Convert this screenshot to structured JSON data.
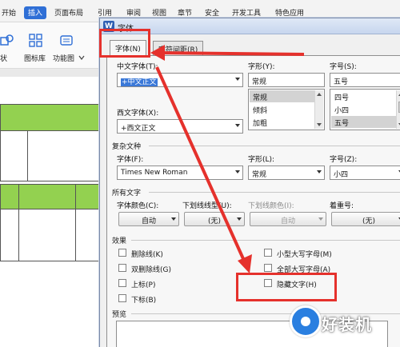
{
  "ribbon": {
    "tabs": [
      "开始",
      "插入",
      "页面布局",
      "引用",
      "审阅",
      "视图",
      "章节",
      "安全",
      "开发工具",
      "特色应用"
    ],
    "active_tab": "插入",
    "buttons": [
      "状",
      "图标库",
      "功能图"
    ]
  },
  "dialog": {
    "title": "字体",
    "tabs": [
      "字体(N)",
      "字符间距(R)"
    ],
    "chinese_font": {
      "label": "中文字体(T):",
      "value": "+中文正文"
    },
    "style": {
      "label": "字形(Y):",
      "value": "常规",
      "options": [
        "常规",
        "倾斜",
        "加粗"
      ],
      "selected": "常规"
    },
    "size": {
      "label": "字号(S):",
      "value": "五号",
      "options": [
        "四号",
        "小四",
        "五号"
      ],
      "selected": "五号"
    },
    "western_font": {
      "label": "西文字体(X):",
      "value": "+西文正文"
    },
    "complex": {
      "section": "复杂文种",
      "font_label": "字体(F):",
      "font_value": "Times New Roman",
      "style_label": "字形(L):",
      "style_value": "常规",
      "size_label": "字号(Z):",
      "size_value": "小四"
    },
    "all_text": {
      "section": "所有文字",
      "color_label": "字体颜色(C):",
      "color_value": "自动",
      "underline_label": "下划线线型(U):",
      "underline_value": "(无)",
      "underline_color_label": "下划线颜色(I):",
      "underline_color_value": "自动",
      "emphasis_label": "着重号:",
      "emphasis_value": "(无)"
    },
    "effects": {
      "section": "效果",
      "items": [
        "删除线(K)",
        "双删除线(G)",
        "上标(P)",
        "下标(B)",
        "小型大写字母(M)",
        "全部大写字母(A)",
        "隐藏文字(H)"
      ]
    },
    "preview": {
      "section": "预览"
    }
  },
  "watermark": {
    "text": "好装机"
  },
  "annotation_color": "#e5312c"
}
